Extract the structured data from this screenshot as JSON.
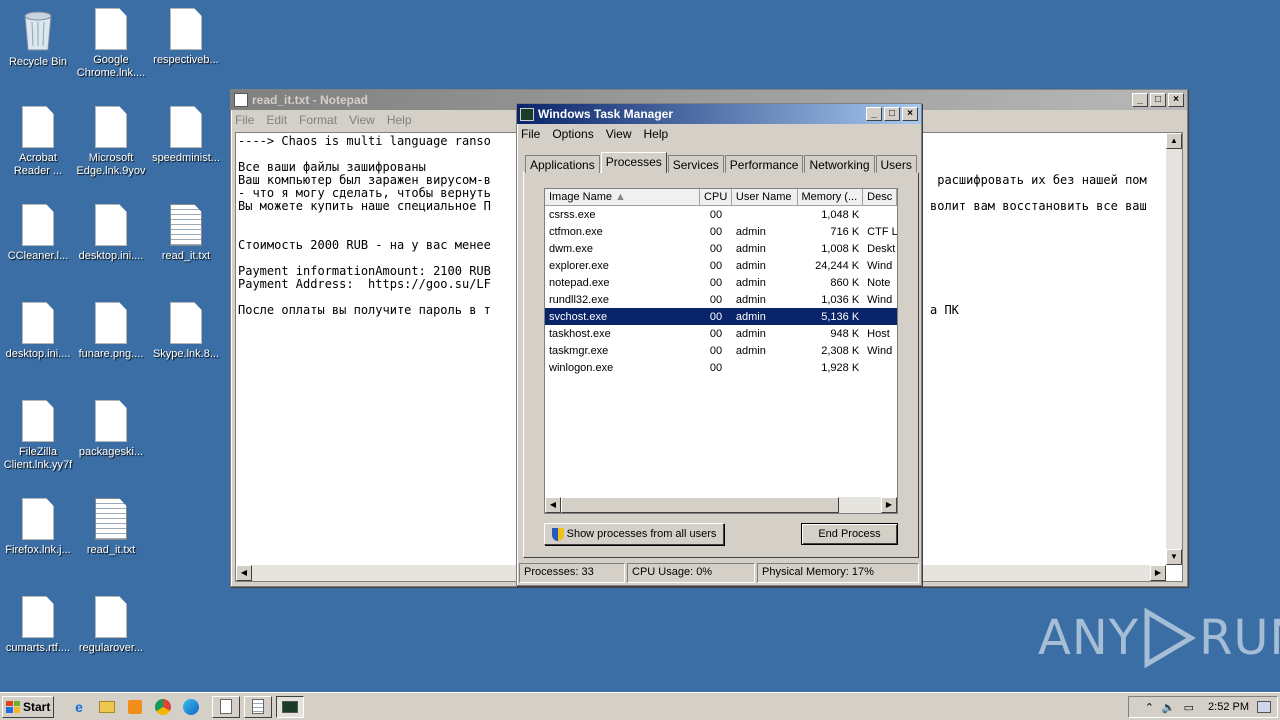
{
  "desktop": {
    "icons": [
      {
        "label": "Recycle Bin",
        "icon": "recycle-bin-icon"
      },
      {
        "label": "Google Chrome.lnk....",
        "icon": "file-icon"
      },
      {
        "label": "respectiveb...",
        "icon": "file-icon"
      },
      {
        "label": "Acrobat Reader ...",
        "icon": "file-icon"
      },
      {
        "label": "Microsoft Edge.lnk.9yov",
        "icon": "file-icon"
      },
      {
        "label": "speedminist...",
        "icon": "file-icon"
      },
      {
        "label": "CCleaner.l...",
        "icon": "file-icon"
      },
      {
        "label": "desktop.ini....",
        "icon": "file-icon"
      },
      {
        "label": "read_it.txt",
        "icon": "text-file-icon"
      },
      {
        "label": "desktop.ini....",
        "icon": "file-icon"
      },
      {
        "label": "funare.png....",
        "icon": "file-icon"
      },
      {
        "label": "Skype.lnk.8...",
        "icon": "file-icon"
      },
      {
        "label": "FileZilla Client.lnk.yy7f",
        "icon": "file-icon"
      },
      {
        "label": "packageski...",
        "icon": "file-icon"
      },
      {
        "label": "Firefox.lnk.j...",
        "icon": "file-icon"
      },
      {
        "label": "read_it.txt",
        "icon": "text-file-icon"
      },
      {
        "label": "cumarts.rtf....",
        "icon": "file-icon"
      },
      {
        "label": "regularover...",
        "icon": "file-icon"
      }
    ]
  },
  "notepad": {
    "title": "read_it.txt - Notepad",
    "menu": [
      "File",
      "Edit",
      "Format",
      "View",
      "Help"
    ],
    "text_left": "----> Chaos is multi language ranso\n\nВсе ваши файлы зашифрованы\nВаш компьютер был заражен вирусом-в\n- что я могу сделать, чтобы вернуть\nВы можете купить наше специальное П\n\n\nСтоимость 2000 RUB - на у вас менее\n\nPayment informationAmount: 2100 RUB\nPayment Address:  https://goo.su/LF\n\nПосле оплаты вы получите пароль в т",
    "text_right": "\n\n\n расшифровать их без нашей пом\n\nволит вам восстановить все ваш\n\n\n\n\n\n\n\nа ПК"
  },
  "taskmgr": {
    "title": "Windows Task Manager",
    "menu": [
      "File",
      "Options",
      "View",
      "Help"
    ],
    "tabs": [
      "Applications",
      "Processes",
      "Services",
      "Performance",
      "Networking",
      "Users"
    ],
    "selected_tab": "Processes",
    "columns": [
      "Image Name",
      "CPU",
      "User Name",
      "Memory (...",
      "Desc"
    ],
    "rows": [
      {
        "name": "csrss.exe",
        "cpu": "00",
        "user": "",
        "mem": "1,048 K",
        "desc": ""
      },
      {
        "name": "ctfmon.exe",
        "cpu": "00",
        "user": "admin",
        "mem": "716 K",
        "desc": "CTF L"
      },
      {
        "name": "dwm.exe",
        "cpu": "00",
        "user": "admin",
        "mem": "1,008 K",
        "desc": "Deskt"
      },
      {
        "name": "explorer.exe",
        "cpu": "00",
        "user": "admin",
        "mem": "24,244 K",
        "desc": "Wind"
      },
      {
        "name": "notepad.exe",
        "cpu": "00",
        "user": "admin",
        "mem": "860 K",
        "desc": "Note"
      },
      {
        "name": "rundll32.exe",
        "cpu": "00",
        "user": "admin",
        "mem": "1,036 K",
        "desc": "Wind"
      },
      {
        "name": "svchost.exe",
        "cpu": "00",
        "user": "admin",
        "mem": "5,136 K",
        "desc": ""
      },
      {
        "name": "taskhost.exe",
        "cpu": "00",
        "user": "admin",
        "mem": "948 K",
        "desc": "Host"
      },
      {
        "name": "taskmgr.exe",
        "cpu": "00",
        "user": "admin",
        "mem": "2,308 K",
        "desc": "Wind"
      },
      {
        "name": "winlogon.exe",
        "cpu": "00",
        "user": "",
        "mem": "1,928 K",
        "desc": ""
      }
    ],
    "selected_row": "svchost.exe",
    "show_all_label": "Show processes from all users",
    "end_process_label": "End Process",
    "status": {
      "processes": "Processes: 33",
      "cpu": "CPU Usage: 0%",
      "memory": "Physical Memory: 17%"
    }
  },
  "taskbar": {
    "start_label": "Start",
    "clock": "2:52 PM"
  },
  "watermark": {
    "text_left": "ANY",
    "text_right": "RUN"
  }
}
